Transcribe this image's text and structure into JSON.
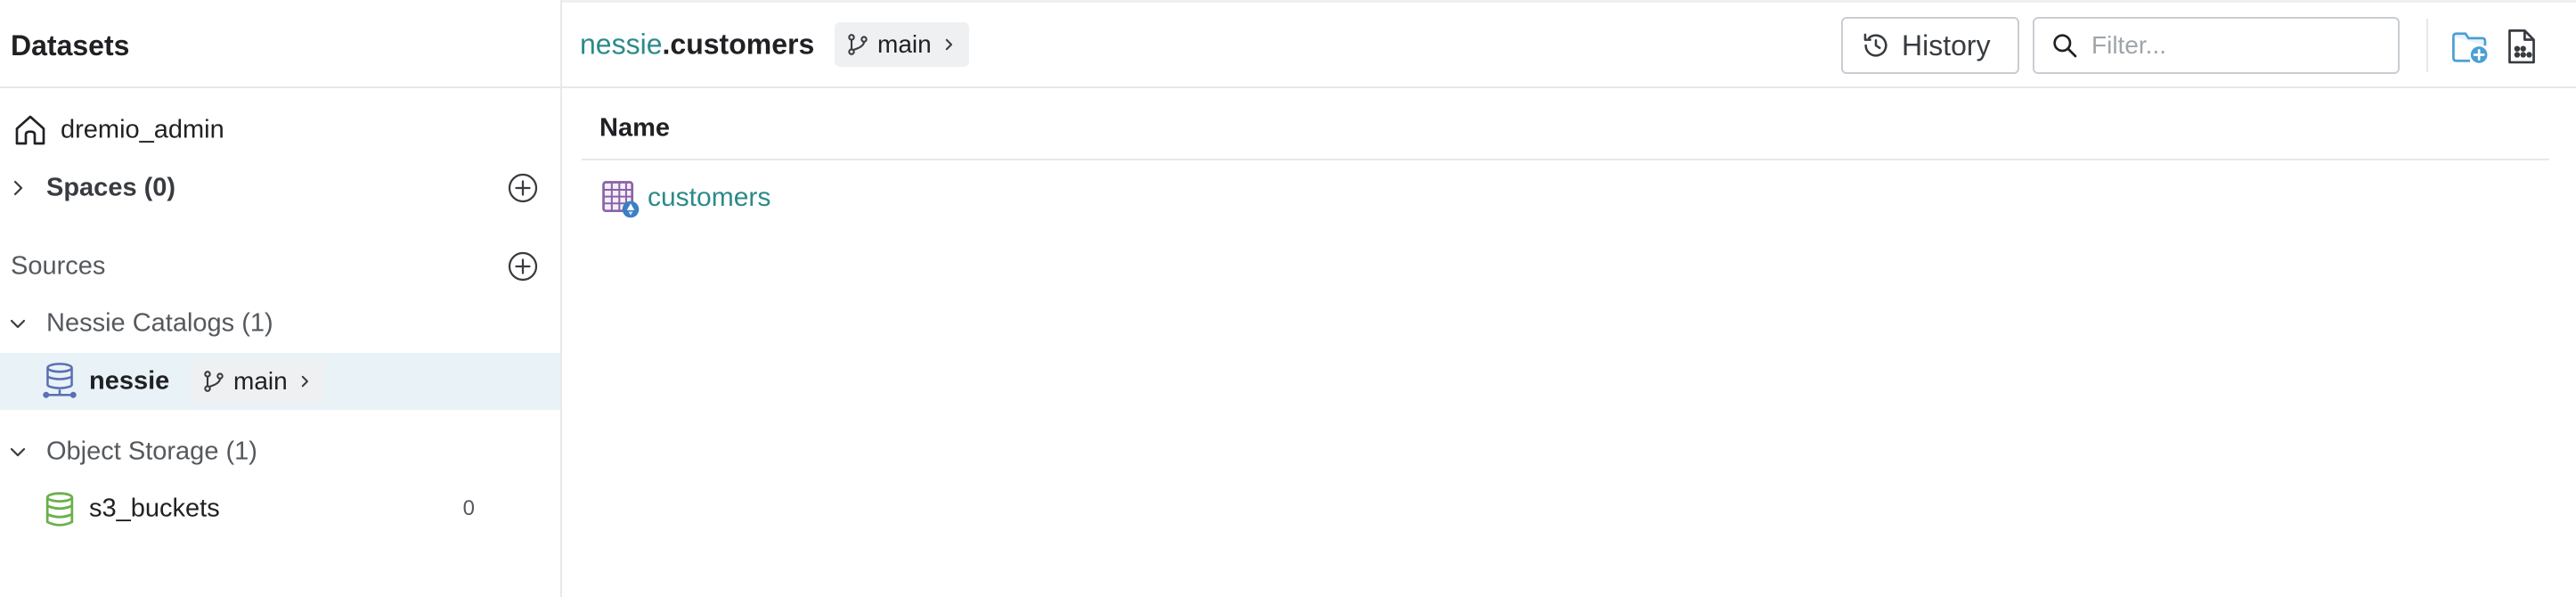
{
  "sidebar": {
    "title": "Datasets",
    "home": {
      "label": "dremio_admin",
      "icon": "home-icon"
    },
    "spaces": {
      "label": "Spaces (0)",
      "icon": "chevron-right-icon",
      "action_icon": "add-circle-icon"
    },
    "sources": {
      "label": "Sources",
      "action_icon": "add-circle-icon"
    },
    "groups": [
      {
        "label": "Nessie Catalogs (1)",
        "icon": "chevron-down-icon",
        "items": [
          {
            "label": "nessie",
            "icon": "nessie-catalog-icon",
            "branch": "main",
            "selected": true
          }
        ]
      },
      {
        "label": "Object Storage (1)",
        "icon": "chevron-down-icon",
        "items": [
          {
            "label": "s3_buckets",
            "icon": "object-storage-icon",
            "count": "0"
          }
        ]
      }
    ]
  },
  "main": {
    "breadcrumb": {
      "source": "nessie",
      "separator": ".",
      "current": "customers"
    },
    "branch": "main",
    "history_label": "History",
    "filter_placeholder": "Filter...",
    "actions": [
      "add-folder-icon",
      "add-file-icon"
    ],
    "table": {
      "columns": [
        "Name"
      ],
      "rows": [
        {
          "name": "customers",
          "icon": "iceberg-table-icon"
        }
      ]
    }
  },
  "colors": {
    "link": "#2d8a8a",
    "selected_row": "#e9f2f6",
    "chip_bg": "#eef0f2",
    "accent_icon": "#4b9fd6",
    "nessie_icon": "#5a6fb4",
    "storage_icon": "#6ab04c",
    "table_icon": "#8a63a8"
  }
}
